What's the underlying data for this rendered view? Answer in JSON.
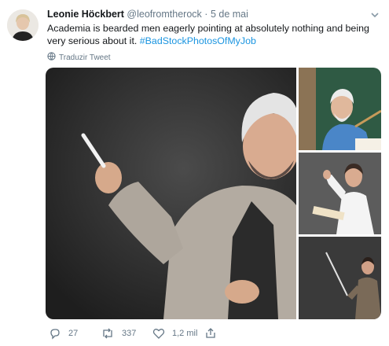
{
  "tweet": {
    "display_name": "Leonie Höckbert",
    "handle": "@leofromtherock",
    "separator": "·",
    "date": "5 de mai",
    "text_main": "Academia is bearded men eagerly pointing at absolutely nothing and being very serious about it.",
    "hashtag": "#BadStockPhotosOfMyJob",
    "translate_label": "Traduzir Tweet"
  },
  "actions": {
    "reply_count": "27",
    "retweet_count": "337",
    "like_count": "1,2 mil"
  },
  "icons": [
    "chevron-down-icon",
    "globe-icon",
    "reply-icon",
    "retweet-icon",
    "heart-icon",
    "share-icon"
  ],
  "colors": {
    "link": "#1b95e0",
    "secondary_text": "#657786",
    "primary_text": "#14171a"
  }
}
